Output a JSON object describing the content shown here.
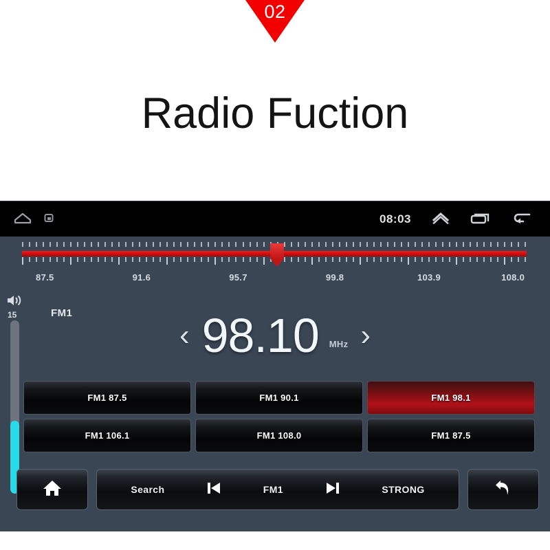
{
  "banner": {
    "badge_number": "02",
    "title": "Radio Fuction",
    "badge_color": "#f20000"
  },
  "statusbar": {
    "clock": "08:03",
    "icons": {
      "home": "home-outline-icon",
      "app": "app-square-icon",
      "expand": "chevron-up-icon",
      "recents": "recents-icon",
      "back": "back-arrow-icon"
    }
  },
  "tuner": {
    "band": "FM1",
    "frequency": "98.10",
    "unit": "MHz",
    "prev_chevron": "‹",
    "next_chevron": "›",
    "thumb_position_percent": 50.5,
    "scale_labels": [
      {
        "text": "87.5",
        "pos": 4.5
      },
      {
        "text": "91.6",
        "pos": 23.5
      },
      {
        "text": "95.7",
        "pos": 42.5
      },
      {
        "text": "99.8",
        "pos": 61.5
      },
      {
        "text": "103.9",
        "pos": 80.0
      },
      {
        "text": "108.0",
        "pos": 96.5
      }
    ]
  },
  "volume": {
    "icon": "speaker-icon",
    "level": "15",
    "fill_percent": 42,
    "fill_color": "#27dbe8"
  },
  "presets": [
    {
      "label": "FM1 87.5",
      "active": false
    },
    {
      "label": "FM1 90.1",
      "active": false
    },
    {
      "label": "FM1 98.1",
      "active": true
    },
    {
      "label": "FM1 106.1",
      "active": false
    },
    {
      "label": "FM1 108.0",
      "active": false
    },
    {
      "label": "FM1 87.5",
      "active": false
    }
  ],
  "toolbar": {
    "home_icon": "home-solid-icon",
    "search_label": "Search",
    "prev_icon": "skip-previous-icon",
    "band_label": "FM1",
    "next_icon": "skip-next-icon",
    "strength_label": "STRONG",
    "return_icon": "return-arrow-icon"
  },
  "colors": {
    "panel_bg": "#3b4655",
    "statusbar_bg": "#000000",
    "accent_red": "#cc0d0d",
    "accent_cyan": "#27dbe8"
  }
}
